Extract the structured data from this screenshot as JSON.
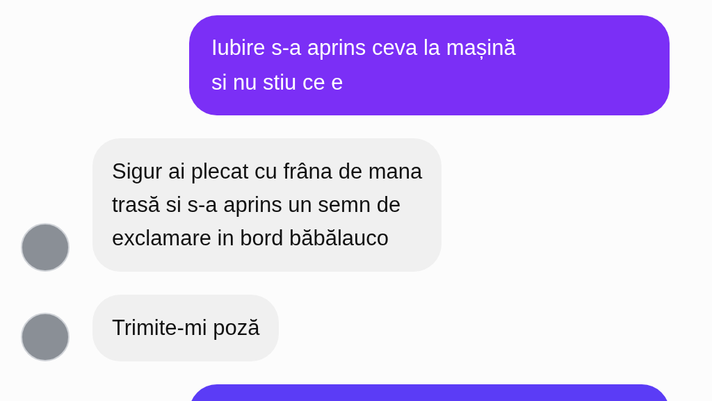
{
  "messages": [
    {
      "kind": "sent",
      "color": "#7b2ff6",
      "lines": [
        "Iubire s-a aprins ceva la mașină",
        "si nu stiu ce e"
      ]
    },
    {
      "kind": "received",
      "avatar": true,
      "lines": [
        "Sigur ai plecat cu frâna de mana",
        "trasă si s-a aprins un semn de",
        "exclamare in bord băbălauco"
      ]
    },
    {
      "kind": "received",
      "avatar": true,
      "lines": [
        "Trimite-mi poză"
      ]
    },
    {
      "kind": "sent",
      "color": "#5b3cf6"
    }
  ]
}
